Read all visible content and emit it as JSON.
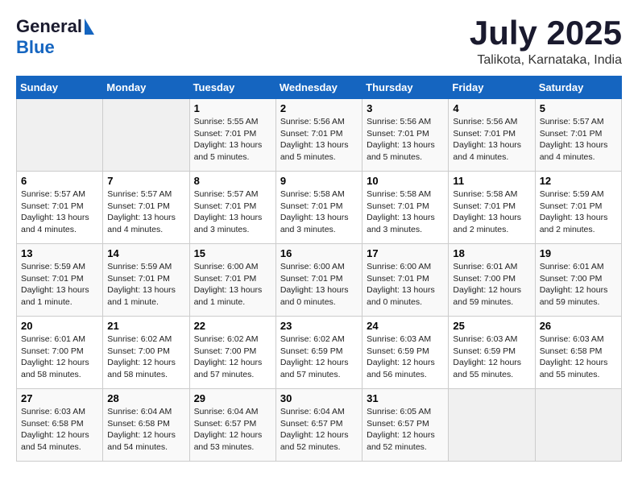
{
  "logo": {
    "general": "General",
    "blue": "Blue"
  },
  "title": "July 2025",
  "location": "Talikota, Karnataka, India",
  "days_header": [
    "Sunday",
    "Monday",
    "Tuesday",
    "Wednesday",
    "Thursday",
    "Friday",
    "Saturday"
  ],
  "weeks": [
    [
      {
        "day": "",
        "info": ""
      },
      {
        "day": "",
        "info": ""
      },
      {
        "day": "1",
        "info": "Sunrise: 5:55 AM\nSunset: 7:01 PM\nDaylight: 13 hours and 5 minutes."
      },
      {
        "day": "2",
        "info": "Sunrise: 5:56 AM\nSunset: 7:01 PM\nDaylight: 13 hours and 5 minutes."
      },
      {
        "day": "3",
        "info": "Sunrise: 5:56 AM\nSunset: 7:01 PM\nDaylight: 13 hours and 5 minutes."
      },
      {
        "day": "4",
        "info": "Sunrise: 5:56 AM\nSunset: 7:01 PM\nDaylight: 13 hours and 4 minutes."
      },
      {
        "day": "5",
        "info": "Sunrise: 5:57 AM\nSunset: 7:01 PM\nDaylight: 13 hours and 4 minutes."
      }
    ],
    [
      {
        "day": "6",
        "info": "Sunrise: 5:57 AM\nSunset: 7:01 PM\nDaylight: 13 hours and 4 minutes."
      },
      {
        "day": "7",
        "info": "Sunrise: 5:57 AM\nSunset: 7:01 PM\nDaylight: 13 hours and 4 minutes."
      },
      {
        "day": "8",
        "info": "Sunrise: 5:57 AM\nSunset: 7:01 PM\nDaylight: 13 hours and 3 minutes."
      },
      {
        "day": "9",
        "info": "Sunrise: 5:58 AM\nSunset: 7:01 PM\nDaylight: 13 hours and 3 minutes."
      },
      {
        "day": "10",
        "info": "Sunrise: 5:58 AM\nSunset: 7:01 PM\nDaylight: 13 hours and 3 minutes."
      },
      {
        "day": "11",
        "info": "Sunrise: 5:58 AM\nSunset: 7:01 PM\nDaylight: 13 hours and 2 minutes."
      },
      {
        "day": "12",
        "info": "Sunrise: 5:59 AM\nSunset: 7:01 PM\nDaylight: 13 hours and 2 minutes."
      }
    ],
    [
      {
        "day": "13",
        "info": "Sunrise: 5:59 AM\nSunset: 7:01 PM\nDaylight: 13 hours and 1 minute."
      },
      {
        "day": "14",
        "info": "Sunrise: 5:59 AM\nSunset: 7:01 PM\nDaylight: 13 hours and 1 minute."
      },
      {
        "day": "15",
        "info": "Sunrise: 6:00 AM\nSunset: 7:01 PM\nDaylight: 13 hours and 1 minute."
      },
      {
        "day": "16",
        "info": "Sunrise: 6:00 AM\nSunset: 7:01 PM\nDaylight: 13 hours and 0 minutes."
      },
      {
        "day": "17",
        "info": "Sunrise: 6:00 AM\nSunset: 7:01 PM\nDaylight: 13 hours and 0 minutes."
      },
      {
        "day": "18",
        "info": "Sunrise: 6:01 AM\nSunset: 7:00 PM\nDaylight: 12 hours and 59 minutes."
      },
      {
        "day": "19",
        "info": "Sunrise: 6:01 AM\nSunset: 7:00 PM\nDaylight: 12 hours and 59 minutes."
      }
    ],
    [
      {
        "day": "20",
        "info": "Sunrise: 6:01 AM\nSunset: 7:00 PM\nDaylight: 12 hours and 58 minutes."
      },
      {
        "day": "21",
        "info": "Sunrise: 6:02 AM\nSunset: 7:00 PM\nDaylight: 12 hours and 58 minutes."
      },
      {
        "day": "22",
        "info": "Sunrise: 6:02 AM\nSunset: 7:00 PM\nDaylight: 12 hours and 57 minutes."
      },
      {
        "day": "23",
        "info": "Sunrise: 6:02 AM\nSunset: 6:59 PM\nDaylight: 12 hours and 57 minutes."
      },
      {
        "day": "24",
        "info": "Sunrise: 6:03 AM\nSunset: 6:59 PM\nDaylight: 12 hours and 56 minutes."
      },
      {
        "day": "25",
        "info": "Sunrise: 6:03 AM\nSunset: 6:59 PM\nDaylight: 12 hours and 55 minutes."
      },
      {
        "day": "26",
        "info": "Sunrise: 6:03 AM\nSunset: 6:58 PM\nDaylight: 12 hours and 55 minutes."
      }
    ],
    [
      {
        "day": "27",
        "info": "Sunrise: 6:03 AM\nSunset: 6:58 PM\nDaylight: 12 hours and 54 minutes."
      },
      {
        "day": "28",
        "info": "Sunrise: 6:04 AM\nSunset: 6:58 PM\nDaylight: 12 hours and 54 minutes."
      },
      {
        "day": "29",
        "info": "Sunrise: 6:04 AM\nSunset: 6:57 PM\nDaylight: 12 hours and 53 minutes."
      },
      {
        "day": "30",
        "info": "Sunrise: 6:04 AM\nSunset: 6:57 PM\nDaylight: 12 hours and 52 minutes."
      },
      {
        "day": "31",
        "info": "Sunrise: 6:05 AM\nSunset: 6:57 PM\nDaylight: 12 hours and 52 minutes."
      },
      {
        "day": "",
        "info": ""
      },
      {
        "day": "",
        "info": ""
      }
    ]
  ]
}
